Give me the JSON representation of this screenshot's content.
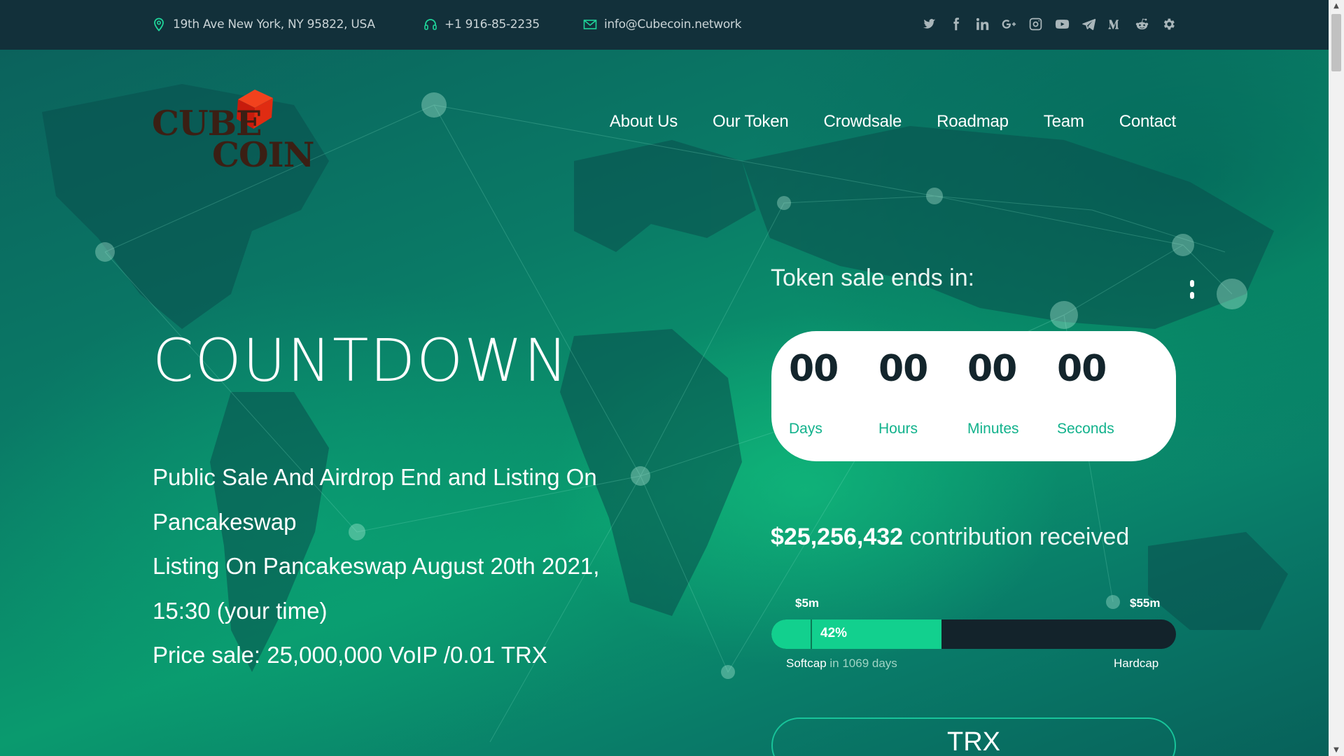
{
  "topbar": {
    "address": "19th Ave New York, NY 95822, USA",
    "phone": "+1 916-85-2235",
    "email": "info@Cubecoin.network",
    "socials": [
      "twitter-icon",
      "facebook-icon",
      "linkedin-icon",
      "google-plus-icon",
      "instagram-icon",
      "youtube-icon",
      "telegram-icon",
      "medium-icon",
      "reddit-icon",
      "settings-icon"
    ]
  },
  "logo": {
    "line1": "CUBE",
    "line2": "COIN"
  },
  "nav": [
    "About Us",
    "Our Token",
    "Crowdsale",
    "Roadmap",
    "Team",
    "Contact"
  ],
  "hero": {
    "title": "COUNTDOWN",
    "line1": "Public Sale And Airdrop End and Listing On Pancakeswap",
    "line2": "Listing On Pancakeswap August 20th 2021, 15:30 (your time)",
    "line3": "Price sale: 25,000,000 VoIP /0.01 TRX"
  },
  "sale": {
    "label": "Token sale ends in:",
    "countdown": [
      {
        "value": "00",
        "unit": "Days"
      },
      {
        "value": "00",
        "unit": "Hours"
      },
      {
        "value": "00",
        "unit": "Minutes"
      },
      {
        "value": "00",
        "unit": "Seconds"
      }
    ],
    "amount": "$25,256,432",
    "amount_suffix": "contribution received",
    "softcap_value": "$5m",
    "hardcap_value": "$55m",
    "progress_label": "42%",
    "progress_fraction": 0.42,
    "softcap_label": "Softcap",
    "softcap_note": "in 1069 days",
    "hardcap_label": "Hardcap",
    "button": "TRX"
  },
  "colors": {
    "accent": "#12d08e",
    "topbar": "#12303a",
    "label": "#12b28c"
  }
}
